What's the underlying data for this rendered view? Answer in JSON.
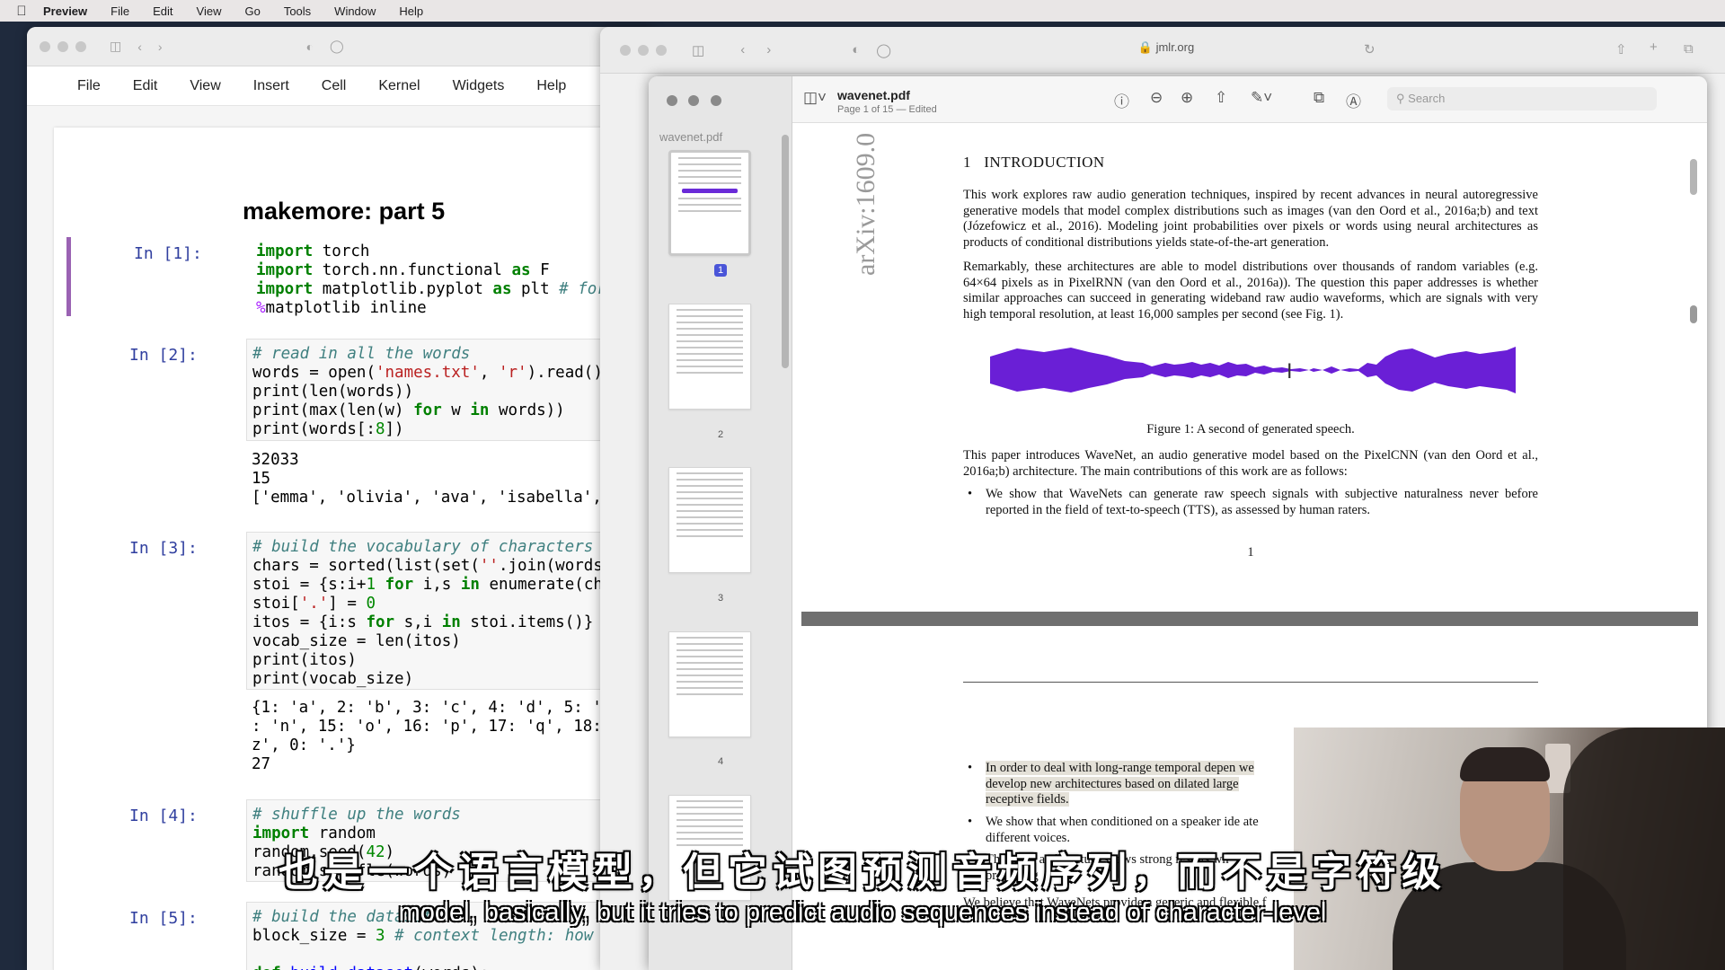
{
  "menubar": {
    "app_name": "Preview",
    "items": [
      "File",
      "Edit",
      "View",
      "Go",
      "Tools",
      "Window",
      "Help"
    ]
  },
  "jupyter": {
    "menu": [
      "File",
      "Edit",
      "View",
      "Insert",
      "Cell",
      "Kernel",
      "Widgets",
      "Help"
    ],
    "title": "makemore: part 5",
    "cells": [
      {
        "prompt": "In [1]:"
      },
      {
        "prompt": "In [2]:",
        "output": "32033\n15\n['emma', 'olivia', 'ava', 'isabella', 's"
      },
      {
        "prompt": "In [3]:",
        "output": "{1: 'a', 2: 'b', 3: 'c', 4: 'd', 5: 'e',\n: 'n', 15: 'o', 16: 'p', 17: 'q', 18: '\nz', 0: '.'}\n27"
      },
      {
        "prompt": "In [4]:"
      },
      {
        "prompt": "In [5]:"
      }
    ]
  },
  "safari": {
    "url": "jmlr.org"
  },
  "preview": {
    "sidebar_title": "wavenet.pdf",
    "doc_name": "wavenet.pdf",
    "doc_status": "Page 1 of 15 — Edited",
    "search_placeholder": "Search",
    "thumb_numbers": [
      "1",
      "2",
      "3",
      "4"
    ],
    "page": {
      "arxiv": "arXiv:1609.0",
      "section_num": "1",
      "section_title": "INTRODUCTION",
      "p1": "This work explores raw audio generation techniques, inspired by recent advances in neural autoregressive generative models that model complex distributions such as images (van den Oord et al., 2016a;b) and text (Józefowicz et al., 2016). Modeling joint probabilities over pixels or words using neural architectures as products of conditional distributions yields state-of-the-art generation.",
      "p2": "Remarkably, these architectures are able to model distributions over thousands of random variables (e.g. 64×64 pixels as in PixelRNN (van den Oord et al., 2016a)). The question this paper addresses is whether similar approaches can succeed in generating wideband raw audio waveforms, which are signals with very high temporal resolution, at least 16,000 samples per second (see Fig. 1).",
      "figure_caption": "Figure 1: A second of generated speech.",
      "p3": "This paper introduces WaveNet, an audio generative model based on the PixelCNN (van den Oord et al., 2016a;b) architecture. The main contributions of this work are as follows:",
      "bullet1": "We show that WaveNets can generate raw speech signals with subjective naturalness never before reported in the field of text-to-speech (TTS), as assessed by human raters.",
      "page_number": "1",
      "p2_bullet1": "In order to deal with long-range temporal depen we develop new architectures based on dilated large receptive fields.",
      "p2_bullet2": "We show that when conditioned on a speaker ide ate different voices.",
      "p2_bullet3": "The same architecture shows strong results wh promising",
      "p2_text": "We believe that WaveNets provide a generic and flexible f"
    }
  },
  "subtitles": {
    "zh": "也是一个语言模型，但它试图预测音频序列，而不是字符级",
    "en": "model, basically, but it tries to predict audio sequences instead of character-level"
  },
  "colors": {
    "waveform": "#6a1fd6",
    "cell_selected": "#9a62b3",
    "prompt": "#303f9f"
  }
}
